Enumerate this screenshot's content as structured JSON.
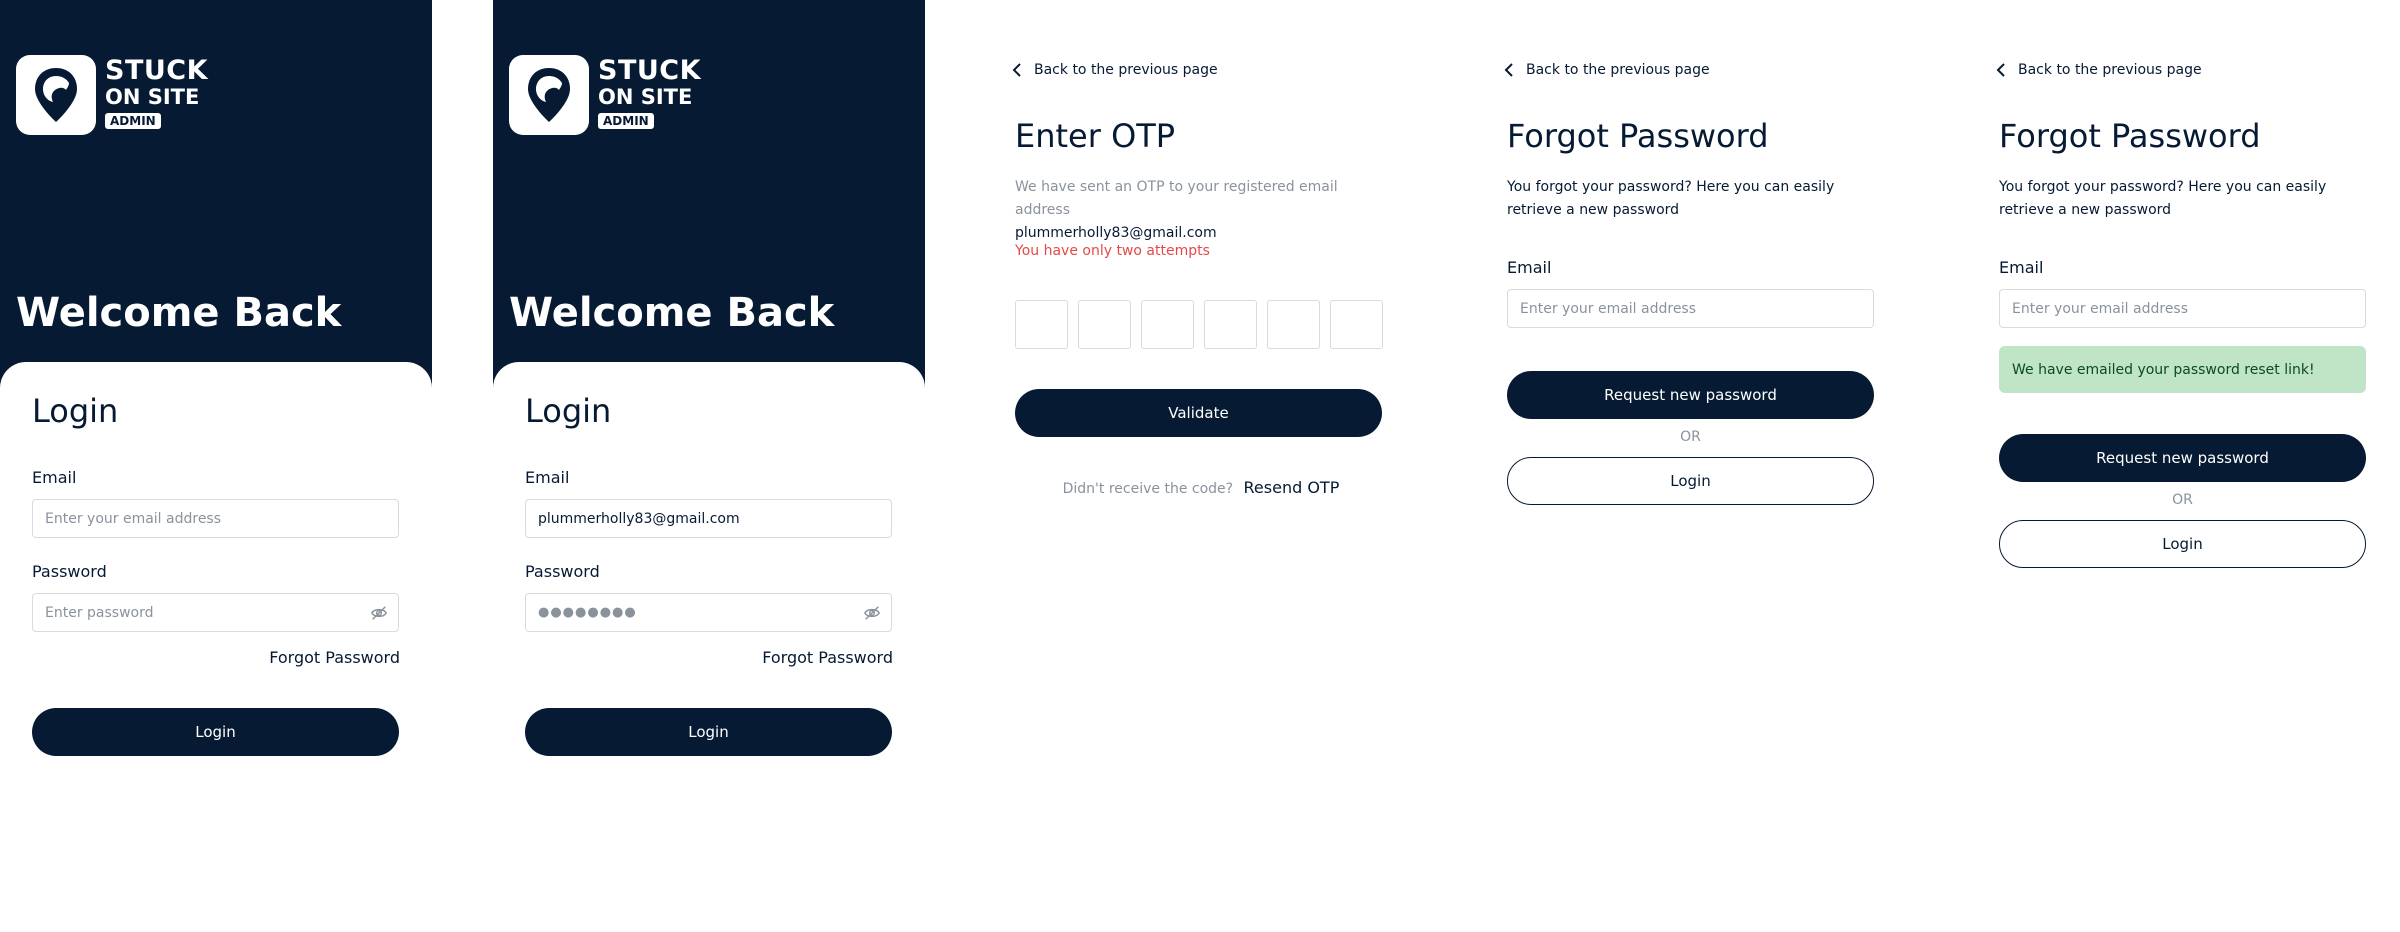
{
  "brand": {
    "line1": "STUCK",
    "line2": "ON SITE",
    "badge": "ADMIN",
    "navy": "#061a33"
  },
  "login_empty": {
    "welcome": "Welcome Back",
    "heading": "Login",
    "email_label": "Email",
    "email_placeholder": "Enter your email address",
    "password_label": "Password",
    "password_placeholder": "Enter password",
    "forgot_link": "Forgot Password",
    "login_button": "Login"
  },
  "login_filled": {
    "welcome": "Welcome Back",
    "heading": "Login",
    "email_label": "Email",
    "email_value": "plummerholly83@gmail.com",
    "password_label": "Password",
    "password_value": "●●●●●●●●",
    "forgot_link": "Forgot Password",
    "login_button": "Login"
  },
  "otp": {
    "back_link": "Back to the previous page",
    "title": "Enter OTP",
    "sent_text": "We have sent an OTP to your registered email address",
    "email": "plummerholly83@gmail.com",
    "attempts_warning": "You have only two attempts",
    "otp_digits": [
      "",
      "",
      "",
      "",
      "",
      ""
    ],
    "validate_button": "Validate",
    "resend_prompt": "Didn't receive the code?",
    "resend_link": "Resend OTP",
    "warning_color": "#e54848"
  },
  "forgot": {
    "back_link": "Back to the previous page",
    "title": "Forgot Password",
    "description": "You forgot your password? Here you can easily retrieve a new password",
    "email_label": "Email",
    "email_placeholder": "Enter your email address",
    "request_button": "Request new password",
    "or_text": "OR",
    "login_button": "Login"
  },
  "forgot_sent": {
    "back_link": "Back to the previous page",
    "title": "Forgot Password",
    "description": "You forgot your password? Here you can easily retrieve a new password",
    "email_label": "Email",
    "email_placeholder": "Enter your email address",
    "success_message": "We have emailed your password reset link!",
    "request_button": "Request new password",
    "or_text": "OR",
    "login_button": "Login",
    "success_color": "#bfe5c6"
  }
}
